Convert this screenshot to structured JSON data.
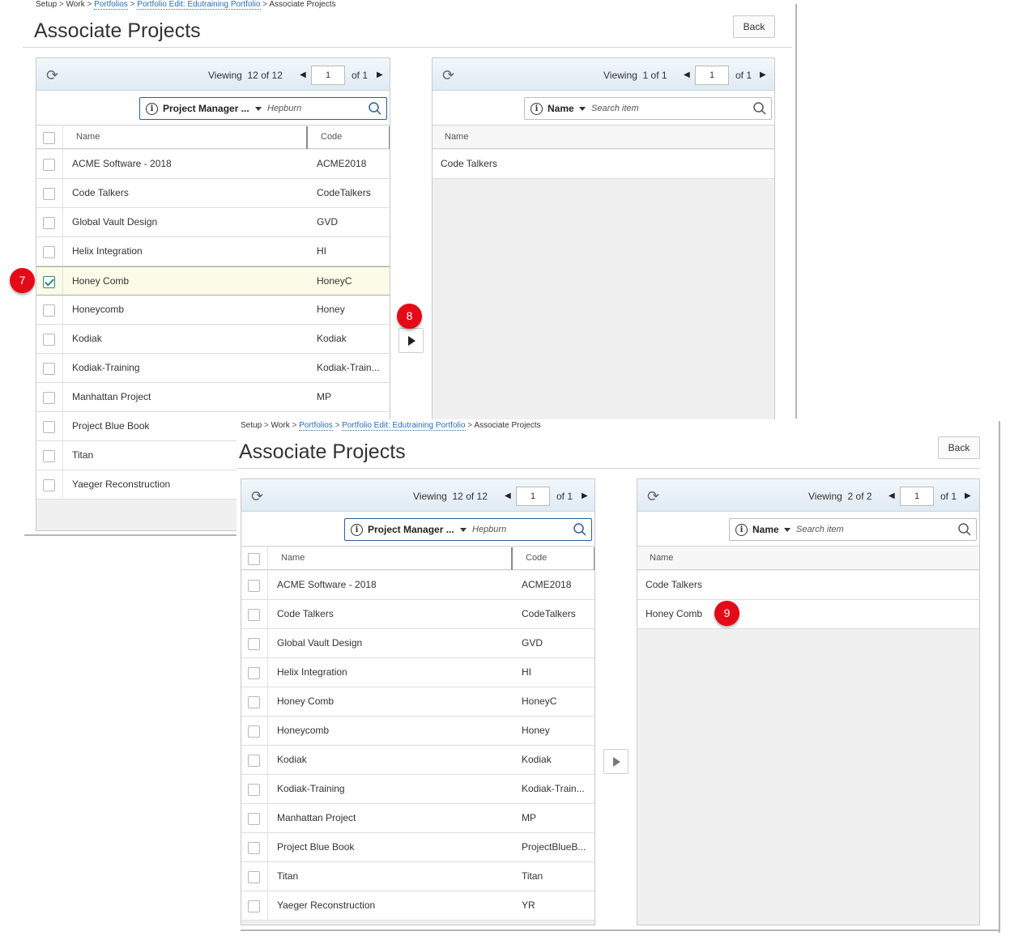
{
  "breadcrumb": {
    "setup": "Setup",
    "sep": ">",
    "work": "Work",
    "portfolios": "Portfolios",
    "portfolio_edit": "Portfolio Edit: Edutraining Portfolio",
    "current": "Associate Projects"
  },
  "page_title": "Associate Projects",
  "back_label": "Back",
  "markers": {
    "m7": "7",
    "m8": "8",
    "m9": "9"
  },
  "shot1": {
    "left": {
      "viewing": "Viewing",
      "count": "12",
      "of_word": "of",
      "total": "12",
      "page": "1",
      "page_of": "of 1",
      "filter_field": "Project Manager ...",
      "filter_value": "Hepburn",
      "col_name": "Name",
      "col_code": "Code",
      "rows": [
        {
          "name": "ACME Software - 2018",
          "code": "ACME2018"
        },
        {
          "name": "Code Talkers",
          "code": "CodeTalkers"
        },
        {
          "name": "Global Vault Design",
          "code": "GVD"
        },
        {
          "name": "Helix Integration",
          "code": "HI"
        },
        {
          "name": "Honey Comb",
          "code": "HoneyC"
        },
        {
          "name": "Honeycomb",
          "code": "Honey"
        },
        {
          "name": "Kodiak",
          "code": "Kodiak"
        },
        {
          "name": "Kodiak-Training",
          "code": "Kodiak-Train..."
        },
        {
          "name": "Manhattan Project",
          "code": "MP"
        },
        {
          "name": "Project Blue Book",
          "code": ""
        },
        {
          "name": "Titan",
          "code": ""
        },
        {
          "name": "Yaeger Reconstruction",
          "code": ""
        }
      ]
    },
    "right": {
      "viewing": "Viewing",
      "count": "1",
      "of_word": "of",
      "total": "1",
      "page": "1",
      "page_of": "of 1",
      "filter_field": "Name",
      "filter_placeholder": "Search item",
      "col_name": "Name",
      "rows": [
        {
          "name": "Code Talkers"
        }
      ]
    }
  },
  "shot2": {
    "left": {
      "viewing": "Viewing",
      "count": "12",
      "of_word": "of",
      "total": "12",
      "page": "1",
      "page_of": "of 1",
      "filter_field": "Project Manager ...",
      "filter_value": "Hepburn",
      "col_name": "Name",
      "col_code": "Code",
      "rows": [
        {
          "name": "ACME Software - 2018",
          "code": "ACME2018"
        },
        {
          "name": "Code Talkers",
          "code": "CodeTalkers"
        },
        {
          "name": "Global Vault Design",
          "code": "GVD"
        },
        {
          "name": "Helix Integration",
          "code": "HI"
        },
        {
          "name": "Honey Comb",
          "code": "HoneyC"
        },
        {
          "name": "Honeycomb",
          "code": "Honey"
        },
        {
          "name": "Kodiak",
          "code": "Kodiak"
        },
        {
          "name": "Kodiak-Training",
          "code": "Kodiak-Train..."
        },
        {
          "name": "Manhattan Project",
          "code": "MP"
        },
        {
          "name": "Project Blue Book",
          "code": "ProjectBlueB..."
        },
        {
          "name": "Titan",
          "code": "Titan"
        },
        {
          "name": "Yaeger Reconstruction",
          "code": "YR"
        }
      ]
    },
    "right": {
      "viewing": "Viewing",
      "count": "2",
      "of_word": "of",
      "total": "2",
      "page": "1",
      "page_of": "of 1",
      "filter_field": "Name",
      "filter_placeholder": "Search item",
      "col_name": "Name",
      "rows": [
        {
          "name": "Code Talkers"
        },
        {
          "name": "Honey Comb"
        }
      ]
    }
  },
  "colors": {
    "marker": "#e30b17",
    "link": "#2a6fb7",
    "toolbar": "#dfeaf3",
    "selected_row": "#fbfbe8"
  }
}
